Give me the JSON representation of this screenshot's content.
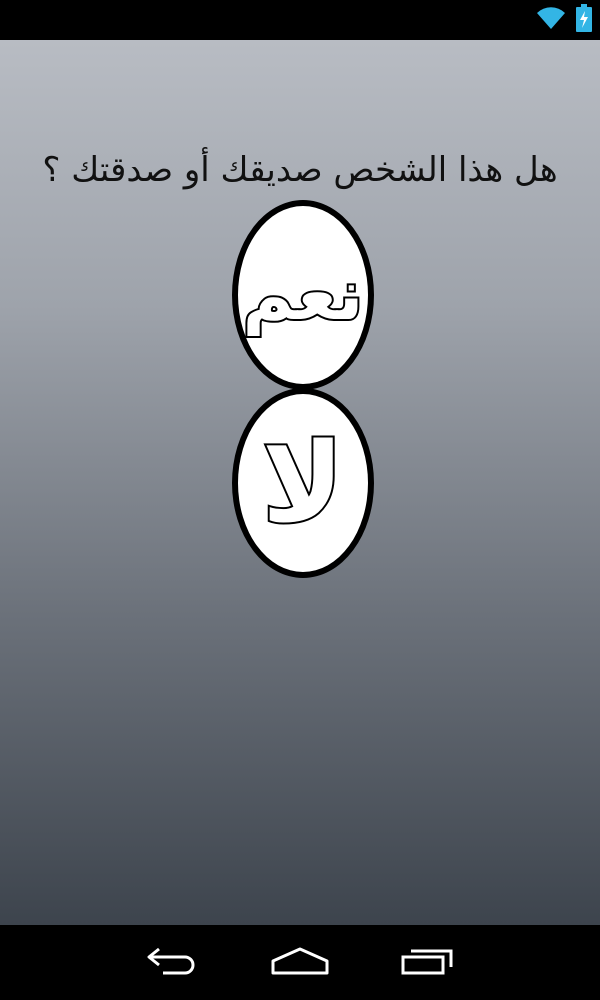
{
  "status_bar": {
    "icons": [
      "wifi-icon",
      "battery-charging-icon"
    ]
  },
  "question": {
    "text": "هل هذا الشخص صديقك أو صدقتك ؟"
  },
  "answers": {
    "yes_label": "نعم",
    "no_label": "لا"
  },
  "nav_bar": {
    "icons": [
      "back-icon",
      "home-icon",
      "recent-apps-icon"
    ]
  },
  "colors": {
    "bar_background": "#000000",
    "gradient_top": "#b8bcc3",
    "gradient_bottom": "#3d444d",
    "text": "#111111",
    "button_fill": "#ffffff",
    "button_border": "#000000"
  }
}
